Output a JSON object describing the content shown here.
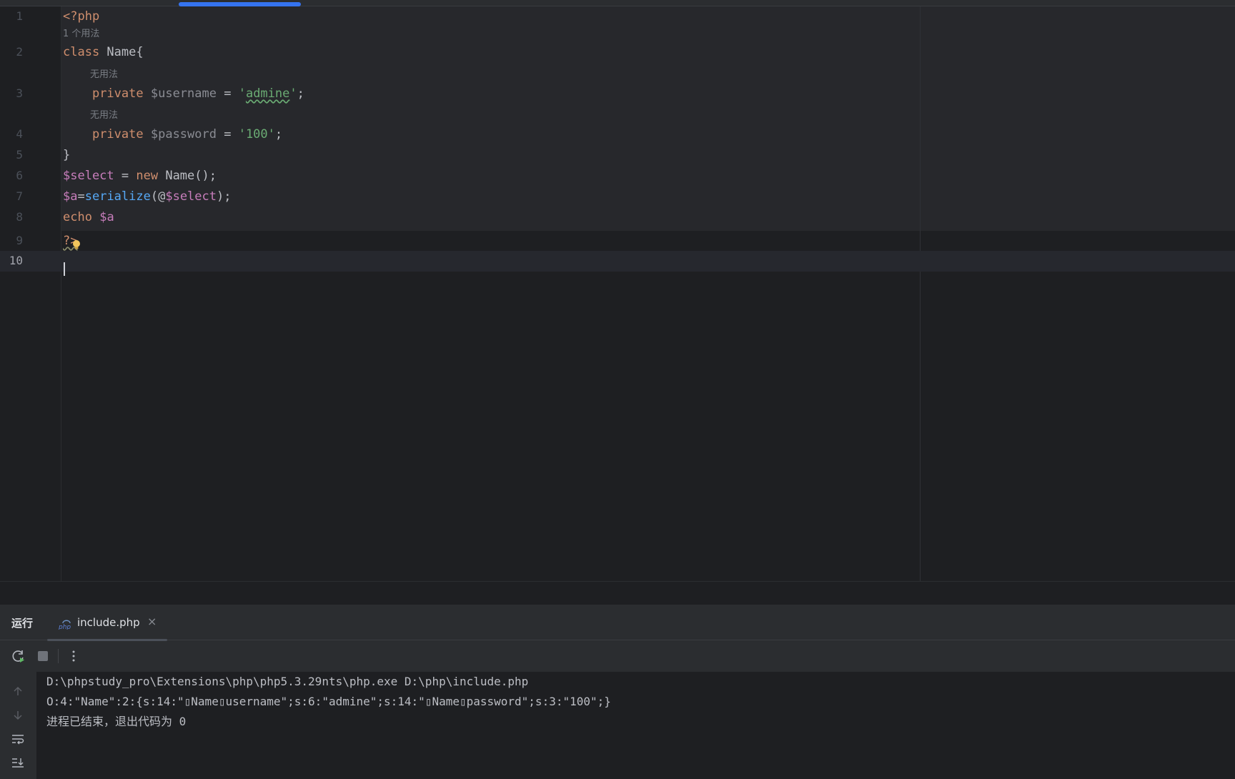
{
  "editor": {
    "hints": {
      "usage_one": "1 个用法",
      "unused_a": "无用法",
      "unused_b": "无用法"
    },
    "lines": [
      {
        "n": "1",
        "parts": [
          "<?php"
        ]
      },
      {
        "n": "2",
        "parts": [
          "class",
          " Name{"
        ]
      },
      {
        "n": "3",
        "parts": [
          "    ",
          "private",
          " ",
          "$username",
          " = ",
          "'",
          "admine",
          "'",
          ";"
        ]
      },
      {
        "n": "4",
        "parts": [
          "    ",
          "private",
          " ",
          "$password",
          " = ",
          "'100'",
          ";"
        ]
      },
      {
        "n": "5",
        "parts": [
          "}"
        ]
      },
      {
        "n": "6",
        "parts": [
          "$select",
          " = ",
          "new",
          " Name();"
        ]
      },
      {
        "n": "7",
        "parts": [
          "$a",
          "=",
          "serialize",
          "(@",
          "$select",
          ");"
        ]
      },
      {
        "n": "8",
        "parts": [
          "echo",
          " ",
          "$a"
        ]
      },
      {
        "n": "9",
        "parts": [
          "?>"
        ]
      },
      {
        "n": "10",
        "parts": [
          ""
        ]
      }
    ]
  },
  "run_panel": {
    "title": "运行",
    "tab_label": "include.php",
    "tab_icon": "php-icon",
    "tab_close": "×",
    "toolbar": [
      "rerun-icon",
      "stop-icon",
      "more-options-icon"
    ],
    "side_tools": [
      "scroll-up-icon",
      "scroll-down-icon",
      "soft-wrap-icon",
      "scroll-to-end-icon"
    ],
    "console": {
      "command": "D:\\phpstudy_pro\\Extensions\\php\\php5.3.29nts\\php.exe D:\\php\\include.php",
      "output": "O:4:\"Name\":2:{s:14:\"▯Name▯username\";s:6:\"admine\";s:14:\"▯Name▯password\";s:3:\"100\";}",
      "exit_message": "进程已结束，退出代码为 0"
    }
  },
  "colors": {
    "keyword": "#cf8e6d",
    "variable": "#c77dbb",
    "string": "#6aab73",
    "function": "#56a8f5",
    "accent": "#3574f0"
  }
}
